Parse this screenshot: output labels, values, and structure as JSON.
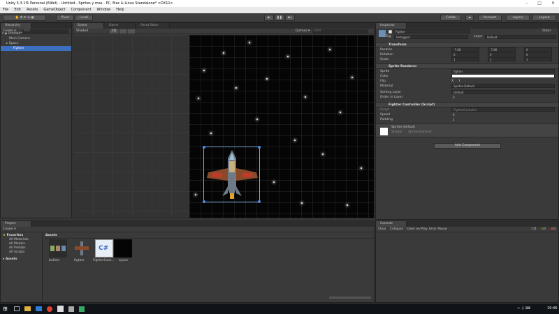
{
  "window": {
    "title": "Unity 5.3.1f1 Personal (64bit) - Untitled - Sprites y mas - PC, Mac & Linux Standalone* <DX11>"
  },
  "menu": [
    "File",
    "Edit",
    "Assets",
    "GameObject",
    "Component",
    "Window",
    "Help"
  ],
  "toolbar": {
    "pivot_label": "Pivot",
    "local_label": "Local",
    "collab_label": "Collab",
    "cloud_label": "☁",
    "account_label": "Account",
    "layers_label": "Layers",
    "layout_label": "Layout",
    "play_icon": "play-icon",
    "pause_icon": "pause-icon",
    "step_icon": "step-icon"
  },
  "hierarchy": {
    "tab": "Hierarchy",
    "create": "Create ▾",
    "search_placeholder": "⚲All",
    "scene": "Untitled*",
    "items": [
      "Main Camera",
      "Space",
      "Fighter"
    ]
  },
  "scene_view": {
    "tabs": [
      "Scene",
      "Game",
      "Asset Store"
    ],
    "shading": "Shaded",
    "mode_2d": "2D",
    "gizmos": "Gizmos ▾",
    "search_placeholder": "⚲All"
  },
  "inspector": {
    "tab": "Inspector",
    "object_name": "Fighter",
    "static_label": "Static",
    "tag_label": "Tag",
    "tag_value": "Untagged",
    "layer_label": "Layer",
    "layer_value": "Default",
    "transform": {
      "title": "Transform",
      "rows": [
        {
          "label": "Position",
          "x": "-7.68",
          "y": "-7.86",
          "z": "0"
        },
        {
          "label": "Rotation",
          "x": "0",
          "y": "0",
          "z": "0"
        },
        {
          "label": "Scale",
          "x": "1",
          "y": "1",
          "z": "1"
        }
      ]
    },
    "sprite_renderer": {
      "title": "Sprite Renderer",
      "sprite_label": "Sprite",
      "sprite_value": "fighter",
      "color_label": "Color",
      "flip_label": "Flip",
      "flip_x": "X",
      "flip_y": "Y",
      "material_label": "Material",
      "material_value": "Sprites-Default",
      "sorting_label": "Sorting Layer",
      "sorting_value": "Default",
      "order_label": "Order in Layer",
      "order_value": "0"
    },
    "fighter_controller": {
      "title": "Fighter Controller (Script)",
      "script_label": "Script",
      "script_value": "FighterController",
      "speed_label": "Speed",
      "speed_value": "6",
      "padding_label": "Padding",
      "padding_value": "2"
    },
    "material": {
      "name": "Sprites-Default",
      "shader_label": "Shader",
      "shader_value": "Sprites/Default"
    },
    "add_component": "Add Component"
  },
  "project": {
    "tab": "Project",
    "create": "Create ▾",
    "favorites_label": "Favorites",
    "favorites": [
      "All Materials",
      "All Models",
      "All Prefabs",
      "All Scripts"
    ],
    "assets_root": "Assets",
    "breadcrumb": "Assets",
    "assets": [
      {
        "name": "bullets",
        "icon": "sprite-sheet-icon"
      },
      {
        "name": "fighter",
        "icon": "fighter-sprite-icon"
      },
      {
        "name": "FighterCont...",
        "icon": "csharp-script-icon"
      },
      {
        "name": "space",
        "icon": "space-texture-icon"
      }
    ],
    "csharp_glyph": "C#"
  },
  "console": {
    "tab": "Console",
    "buttons": [
      "Clear",
      "Collapse",
      "Clear on Play",
      "Error Pause"
    ],
    "counts": [
      "0",
      "0",
      "0"
    ]
  },
  "taskbar": {
    "time": "19:46"
  },
  "colors": {
    "accent": "#3d6fc1",
    "space": "#050505",
    "selection_handle": "#4a8fe8"
  }
}
